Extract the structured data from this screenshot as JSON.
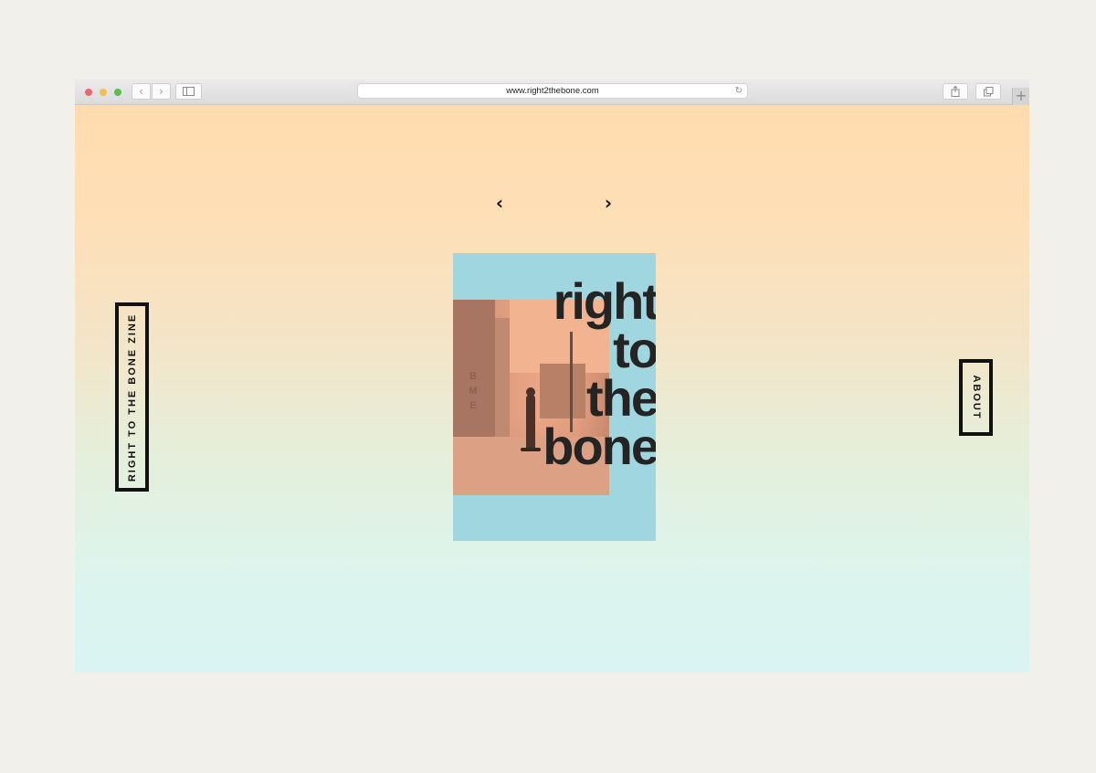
{
  "browser": {
    "url": "www.right2thebone.com",
    "back_icon": "‹",
    "forward_icon": "›",
    "reload_icon": "↻",
    "new_tab_icon": "+"
  },
  "page": {
    "nav": {
      "prev_icon": "‹",
      "next_icon": "›"
    },
    "left_button_label": "RIGHT TO THE BONE ZINE",
    "right_button_label": "ABOUT",
    "cover": {
      "title_lines": [
        "right",
        "to",
        "the",
        "bone"
      ],
      "wall_letters": [
        "B",
        "M",
        "E"
      ]
    }
  },
  "colors": {
    "gradient_top": "#ffdcaf",
    "gradient_bottom": "#daf4f3",
    "cover_background": "#9fd6df",
    "photo_tint": "#eaa687",
    "text_dark": "#242424"
  }
}
